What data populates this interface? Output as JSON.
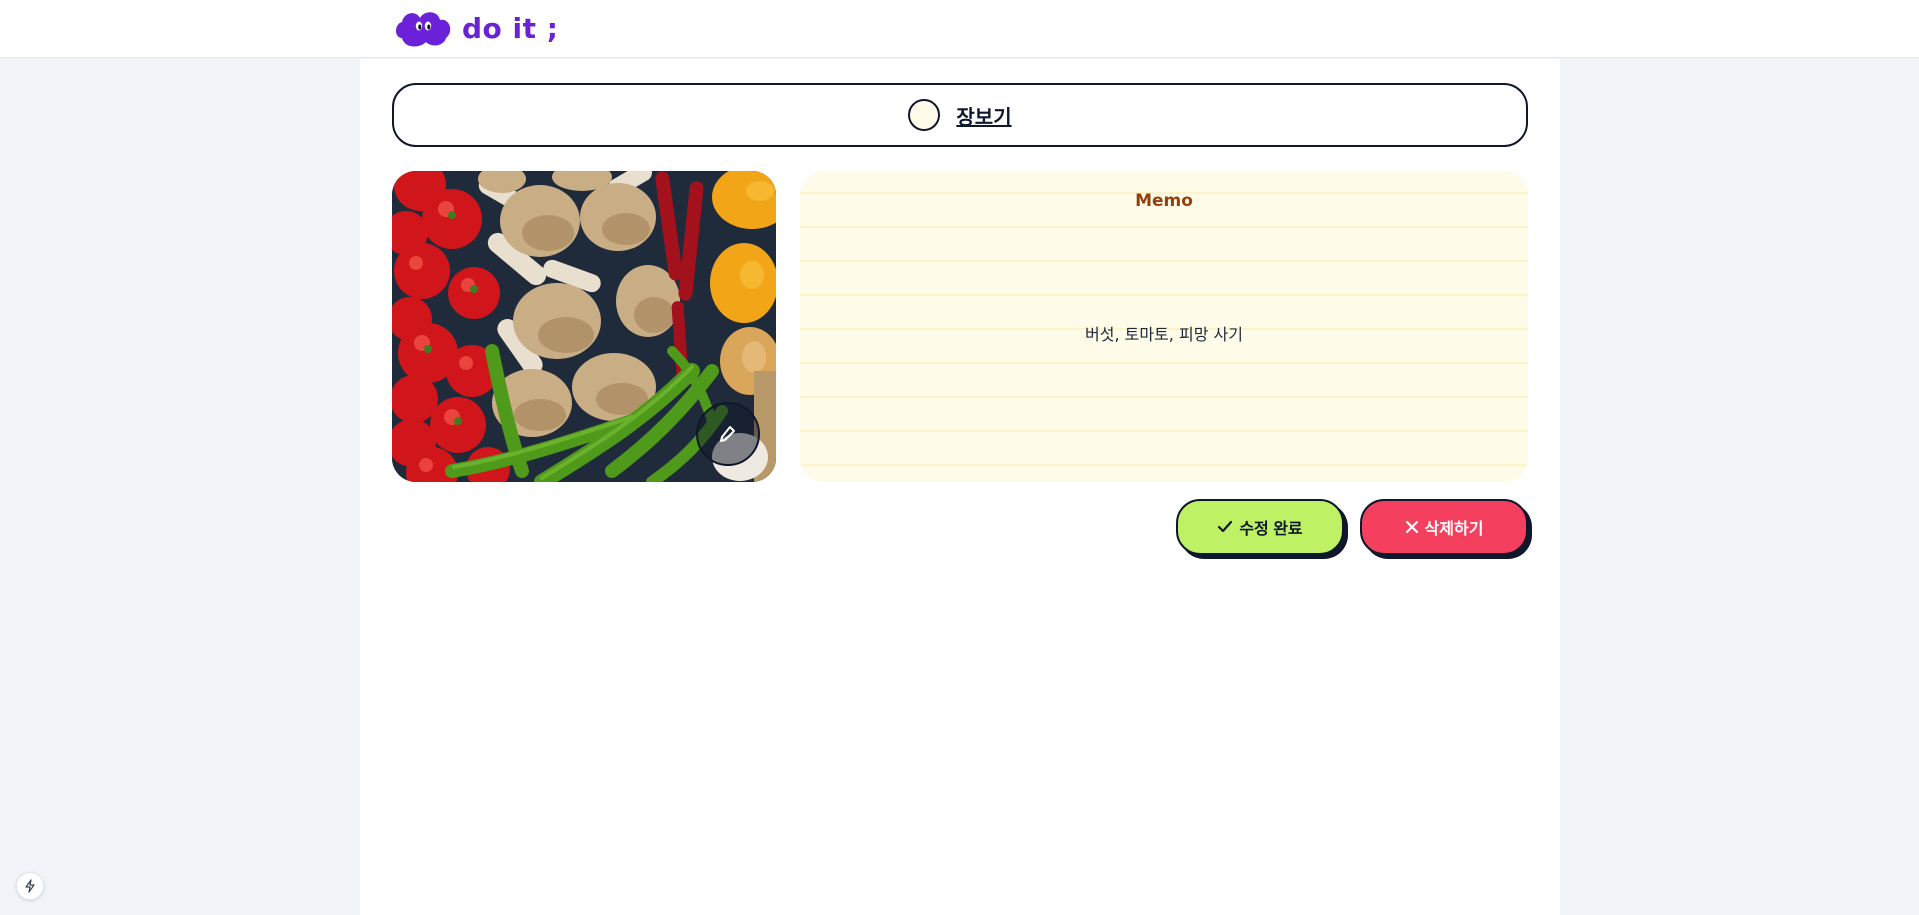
{
  "header": {
    "logo_text": "do it ;",
    "logo_icon": "cloud-mascot-icon",
    "brand_color": "#6b21d8"
  },
  "todo": {
    "name": "장보기",
    "completed": false,
    "check_icon": "unchecked-circle-icon"
  },
  "image": {
    "edit_icon": "pencil-icon"
  },
  "memo": {
    "title": "Memo",
    "text": "버섯, 토마토, 피망 사기"
  },
  "actions": {
    "save_label": "수정 완료",
    "save_icon": "check-icon",
    "save_color": "#bef264",
    "delete_label": "삭제하기",
    "delete_icon": "x-icon",
    "delete_color": "#f43f5e"
  },
  "dev_indicator_icon": "bolt-icon"
}
